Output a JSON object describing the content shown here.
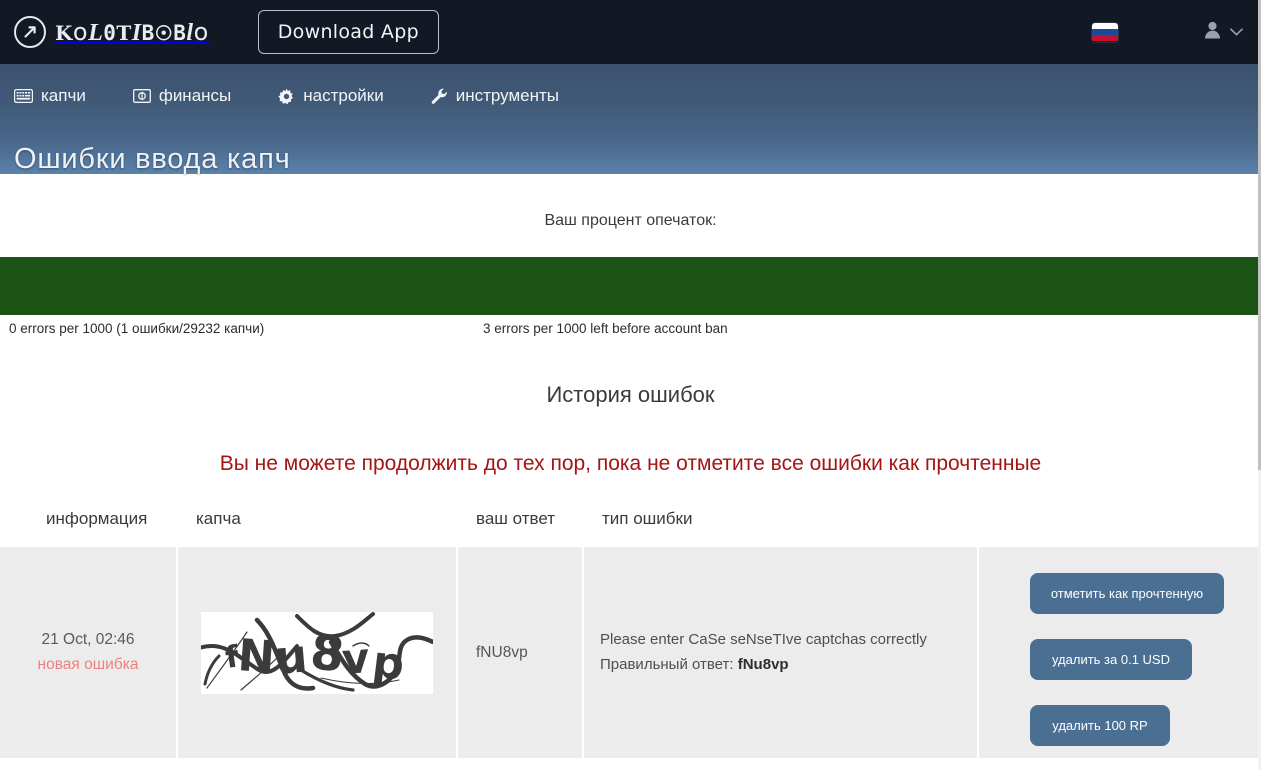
{
  "header": {
    "brand_name": "KOLOTIBABLO",
    "brand_logo_icon": "arrow-in-circle-icon",
    "download_label": "Download App",
    "language_flag": "russia-flag-icon",
    "user_icon": "user-icon",
    "chevron_icon": "chevron-down-icon",
    "colors": {
      "topbar_bg": "#121824",
      "nav_gradient_top": "#3b5270",
      "nav_gradient_bottom": "#5b82ab"
    }
  },
  "nav": {
    "items": [
      {
        "label": "капчи",
        "icon": "keyboard-icon"
      },
      {
        "label": "финансы",
        "icon": "banknote-icon"
      },
      {
        "label": "настройки",
        "icon": "gear-icon"
      },
      {
        "label": "инструменты",
        "icon": "wrench-icon"
      }
    ]
  },
  "page": {
    "title": "Ошибки ввода капч"
  },
  "stats": {
    "percent_label": "Ваш процент опечаток:",
    "bar_fill_percent": 100,
    "bar_color": "#1a5314",
    "errors_summary": "0 errors per 1000 (1 ошибки/29232 капчи)",
    "errors_remaining": "3 errors per 1000 left before account ban"
  },
  "history": {
    "title": "История ошибок",
    "warning": "Вы не можете продолжить до тех пор, пока не отметите все ошибки как прочтенные",
    "warning_color": "#a51414",
    "columns": {
      "info": "информация",
      "captcha": "капча",
      "answer": "ваш ответ",
      "error_type": "тип ошибки"
    },
    "rows": [
      {
        "date": "21 Oct, 02:46",
        "status": "новая ошибка",
        "captcha_text": "fNu8vp",
        "your_answer": "fNU8vp",
        "error_message": "Please enter CaSe seNseTIve captchas correctly",
        "correct_label": "Правильный ответ:",
        "correct_answer": "fNu8vp",
        "actions": {
          "mark_read": "отметить как прочтенную",
          "delete_usd": "удалить за 0.1 USD",
          "delete_rp": "удалить 100 RP"
        }
      }
    ]
  }
}
